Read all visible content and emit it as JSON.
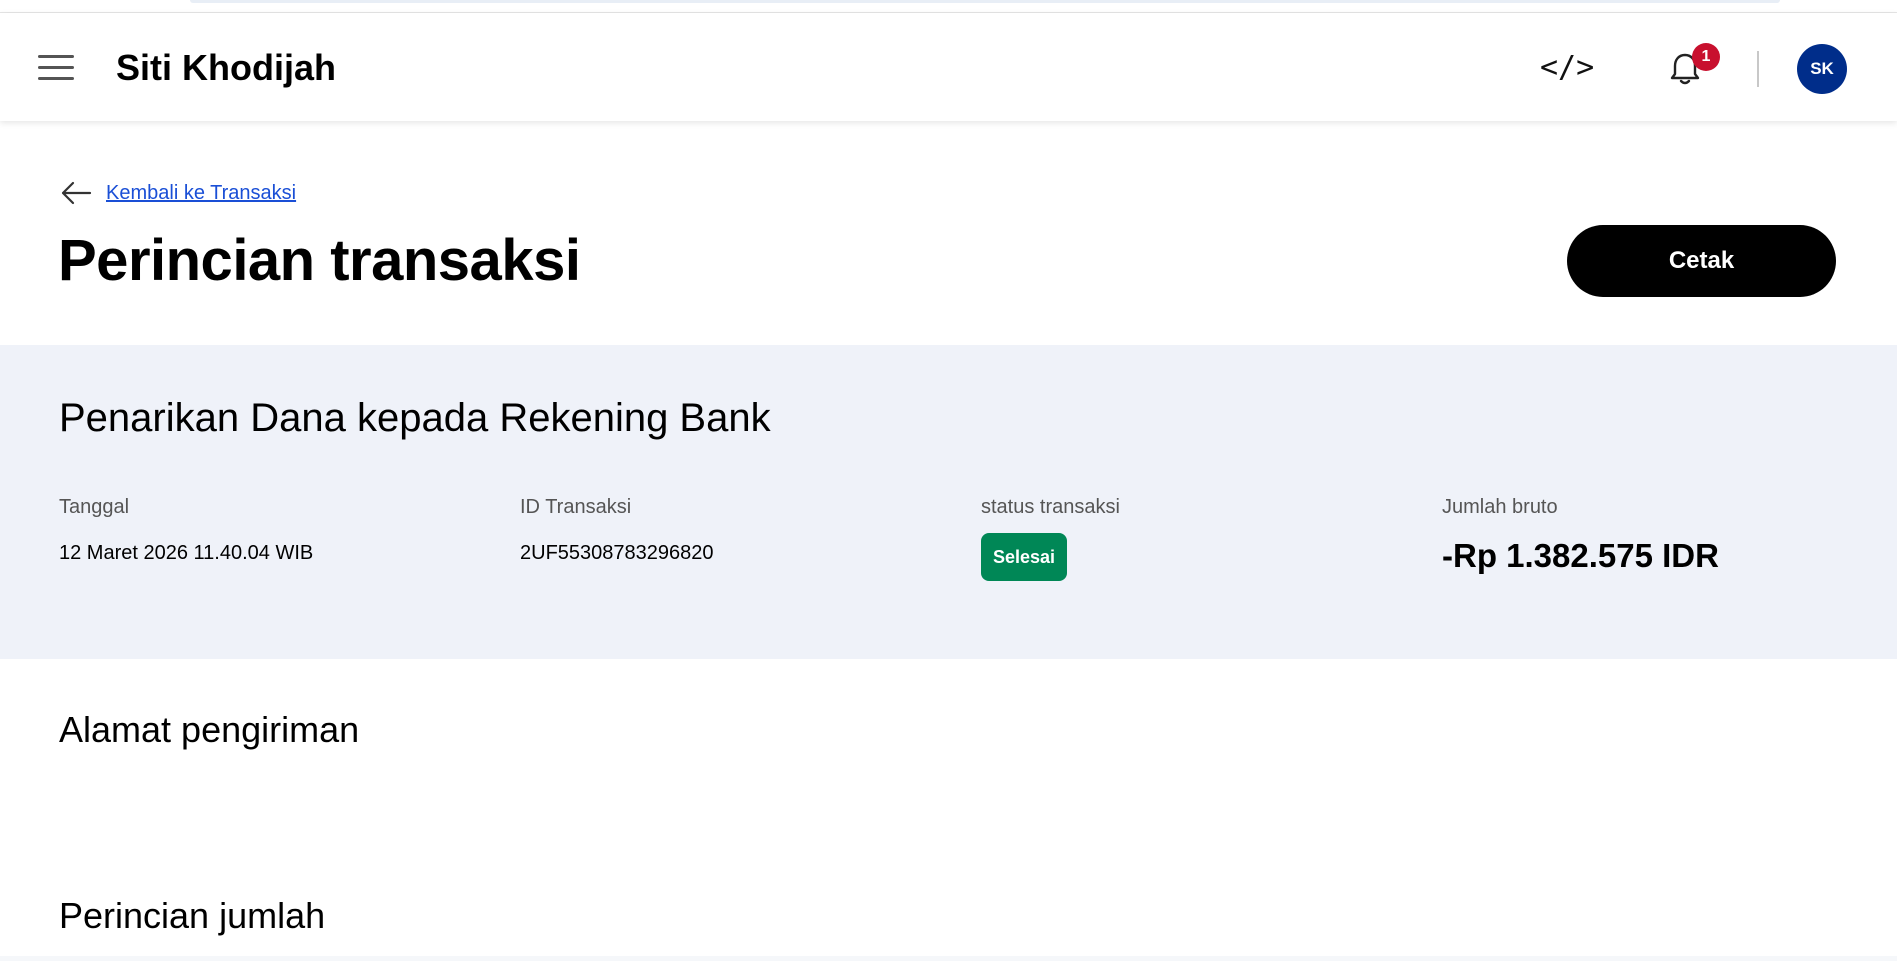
{
  "header": {
    "user_name": "Siti Khodijah",
    "code_icon_glyph": "</>",
    "notification_count": "1",
    "avatar_initials": "SK",
    "avatar_color": "#002d8a",
    "badge_color": "#c8102e"
  },
  "page": {
    "back_link": "Kembali ke Transaksi",
    "title": "Perincian transaksi",
    "print_button": "Cetak"
  },
  "summary": {
    "title": "Penarikan Dana kepada Rekening Bank",
    "date_label": "Tanggal",
    "date_value": "12 Maret 2026 11.40.04 WIB",
    "id_label": "ID Transaksi",
    "id_value": "2UF55308783296820",
    "status_label": "status transaksi",
    "status_value": "Selesai",
    "status_color": "#008756",
    "gross_label": "Jumlah bruto",
    "gross_value": "-Rp 1.382.575 IDR",
    "background": "#eff2f9"
  },
  "sections": {
    "shipping_address": "Alamat pengiriman",
    "amount_details": "Perincian jumlah"
  },
  "icons": {
    "menu": "hamburger-menu-icon",
    "code": "code-icon",
    "bell": "bell-icon",
    "back": "arrow-left-icon"
  }
}
